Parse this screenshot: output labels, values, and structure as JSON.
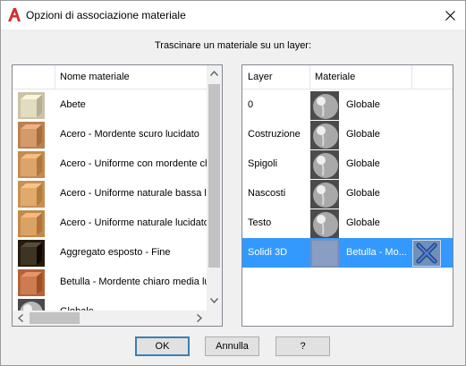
{
  "window": {
    "title": "Opzioni di associazione materiale"
  },
  "instruction": "Trascinare un materiale su un layer:",
  "materials": {
    "column_header": "Nome materiale",
    "items": [
      {
        "label": "Abete",
        "color": "#e2dcc0"
      },
      {
        "label": "Acero - Mordente scuro lucidato",
        "color": "#d49a6a"
      },
      {
        "label": "Acero - Uniforme con mordente ch",
        "color": "#dca468"
      },
      {
        "label": "Acero - Uniforme naturale bassa lu",
        "color": "#e0aa6c"
      },
      {
        "label": "Acero - Uniforme naturale lucidato",
        "color": "#dca265"
      },
      {
        "label": "Aggregato esposto - Fine",
        "color": "#3d3426"
      },
      {
        "label": "Betulla - Mordente chiaro media luc",
        "color": "#cd7c52"
      },
      {
        "label": "Globale",
        "color": "#9a9a9a"
      }
    ]
  },
  "layers": {
    "column_layer": "Layer",
    "column_material": "Materiale",
    "rows": [
      {
        "layer": "0",
        "material": "Globale"
      },
      {
        "layer": "Costruzione",
        "material": "Globale"
      },
      {
        "layer": "Spigoli",
        "material": "Globale"
      },
      {
        "layer": "Nascosti",
        "material": "Globale"
      },
      {
        "layer": "Testo",
        "material": "Globale"
      },
      {
        "layer": "Solidi 3D",
        "material": "Betulla - Mo...",
        "selected": true
      }
    ]
  },
  "buttons": {
    "ok": "OK",
    "cancel": "Annulla",
    "help": "?"
  },
  "colors": {
    "selection": "#3399ff",
    "brand": "#d32f2f"
  }
}
